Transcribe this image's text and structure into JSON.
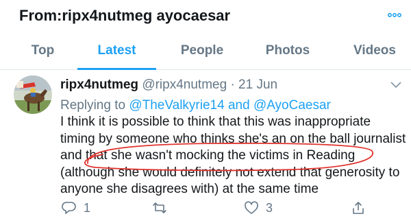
{
  "header": {
    "title": "From:ripx4nutmeg ayocaesar",
    "more_icon": "more-horizontal-icon",
    "accent_color": "#1da1f2"
  },
  "tabs": [
    {
      "label": "Top",
      "active": false
    },
    {
      "label": "Latest",
      "active": true
    },
    {
      "label": "People",
      "active": false
    },
    {
      "label": "Photos",
      "active": false
    },
    {
      "label": "Videos",
      "active": false
    }
  ],
  "tweet": {
    "author_name": "ripx4nutmeg",
    "author_handle": "@ripx4nutmeg",
    "separator": "·",
    "date": "21 Jun",
    "reply_prefix": "Replying to",
    "reply_mention_1": "@TheValkyrie14",
    "reply_and": "and",
    "reply_mention_2": "@AyoCaesar",
    "body_lines": [
      "I think it is possible to think that this was inappropriate",
      "timing by someone who thinks she's an on the ball journalist",
      "and that she wasn't mocking the victims in Reading",
      "(although she would definitely not extend that generosity to",
      "anyone she disagrees with) at the same time"
    ],
    "annotation_color": "#e0332e"
  },
  "actions": {
    "reply_count": "1",
    "retweet_count": "",
    "like_count": "3",
    "icons": [
      "reply-icon",
      "retweet-icon",
      "like-icon",
      "share-icon"
    ]
  }
}
